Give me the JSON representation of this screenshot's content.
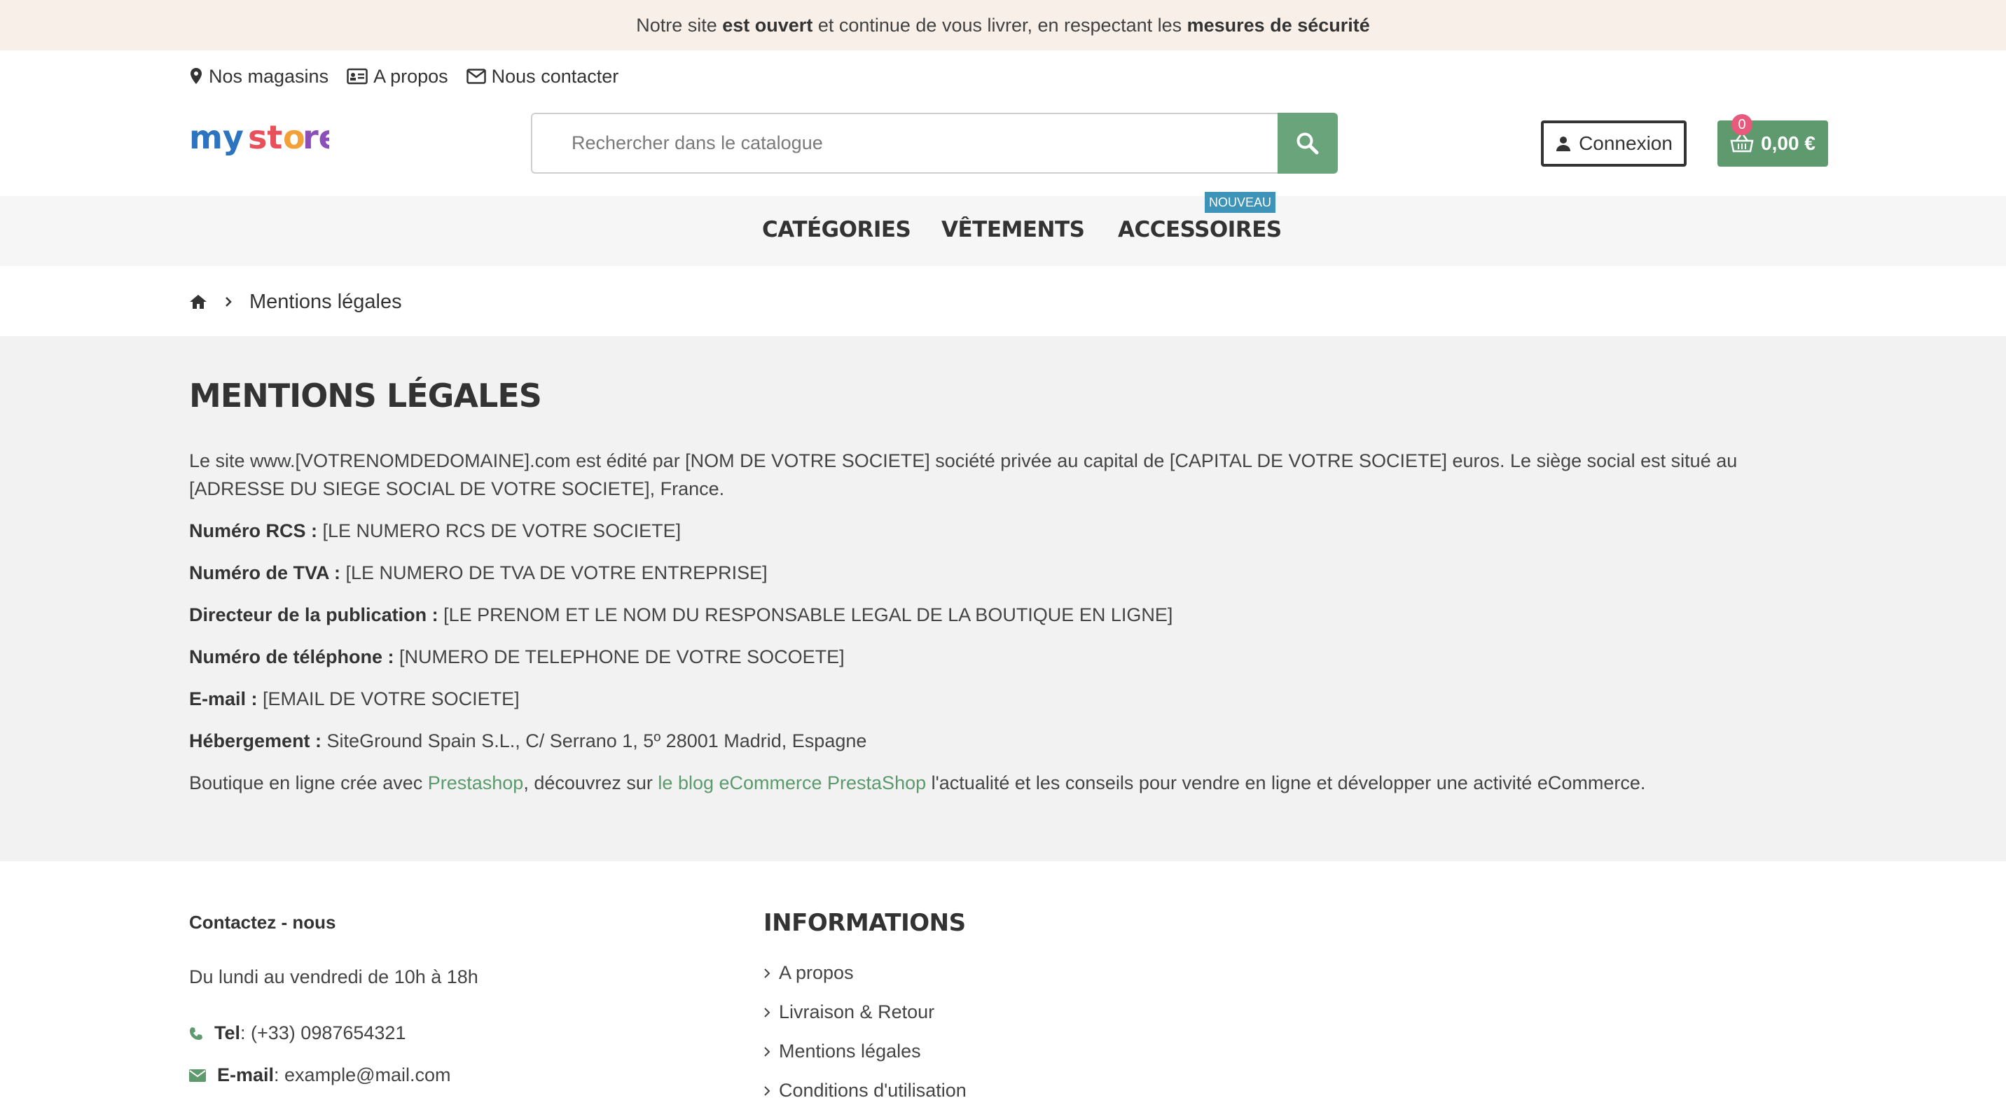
{
  "banner": {
    "pre": "Notre site ",
    "bold1": "est ouvert",
    "mid": " et continue de vous livrer, en respectant les ",
    "bold2": "mesures de sécurité"
  },
  "topnav": {
    "stores": "Nos magasins",
    "about": "A propos",
    "contact": "Nous contacter"
  },
  "logo": {
    "alt": "my store"
  },
  "search": {
    "placeholder": "Rechercher dans le catalogue"
  },
  "account": {
    "login_label": "Connexion"
  },
  "cart": {
    "count": "0",
    "total": "0,00 €"
  },
  "mainnav": {
    "items": [
      "CATÉGORIES",
      "VÊTEMENTS",
      "ACCESSOIRES"
    ],
    "badge": "NOUVEAU"
  },
  "breadcrumb": {
    "current": "Mentions légales"
  },
  "page": {
    "title": "MENTIONS LÉGALES",
    "intro": "Le site www.[VOTRENOMDEDOMAINE].com est édité par [NOM DE VOTRE SOCIETE] société privée au capital de [CAPITAL DE VOTRE SOCIETE] euros. Le siège social est situé au [ADRESSE DU SIEGE SOCIAL DE VOTRE SOCIETE], France.",
    "rows": [
      {
        "label": "Numéro RCS :",
        "value": " [LE NUMERO RCS DE VOTRE SOCIETE]"
      },
      {
        "label": "Numéro de TVA :",
        "value": " [LE NUMERO DE TVA DE VOTRE ENTREPRISE]"
      },
      {
        "label": "Directeur de la publication :",
        "value": " [LE PRENOM ET LE NOM DU RESPONSABLE LEGAL DE LA BOUTIQUE EN LIGNE]"
      },
      {
        "label": "Numéro de téléphone :",
        "value": " [NUMERO DE TELEPHONE DE VOTRE SOCOETE]"
      },
      {
        "label": "E-mail :",
        "value": " [EMAIL DE VOTRE SOCIETE]"
      },
      {
        "label": "Hébergement :",
        "value": " SiteGround Spain S.L., C/ Serrano 1, 5º 28001 Madrid, Espagne"
      }
    ],
    "closing": {
      "pre": "Boutique en ligne crée avec ",
      "link1": "Prestashop",
      "mid": ", découvrez sur ",
      "link2": "le blog eCommerce PrestaShop",
      "post": " l'actualité et les conseils pour vendre en ligne et développer une activité eCommerce."
    }
  },
  "footer": {
    "contact_title": "Contactez - nous",
    "hours": "Du lundi au vendredi de 10h à 18h",
    "tel_label": "Tel",
    "tel_value": ": (+33) 0987654321",
    "email_label": "E-mail",
    "email_value": ": example@mail.com",
    "info_title": "INFORMATIONS",
    "info_links": [
      "A propos",
      "Livraison & Retour",
      "Mentions légales",
      "Conditions d'utilisation"
    ]
  },
  "colors": {
    "accent_green": "#5f9a6e",
    "banner_bg": "#f8f0e8",
    "badge_blue": "#3d93b8",
    "cart_badge": "#e75a7c"
  }
}
